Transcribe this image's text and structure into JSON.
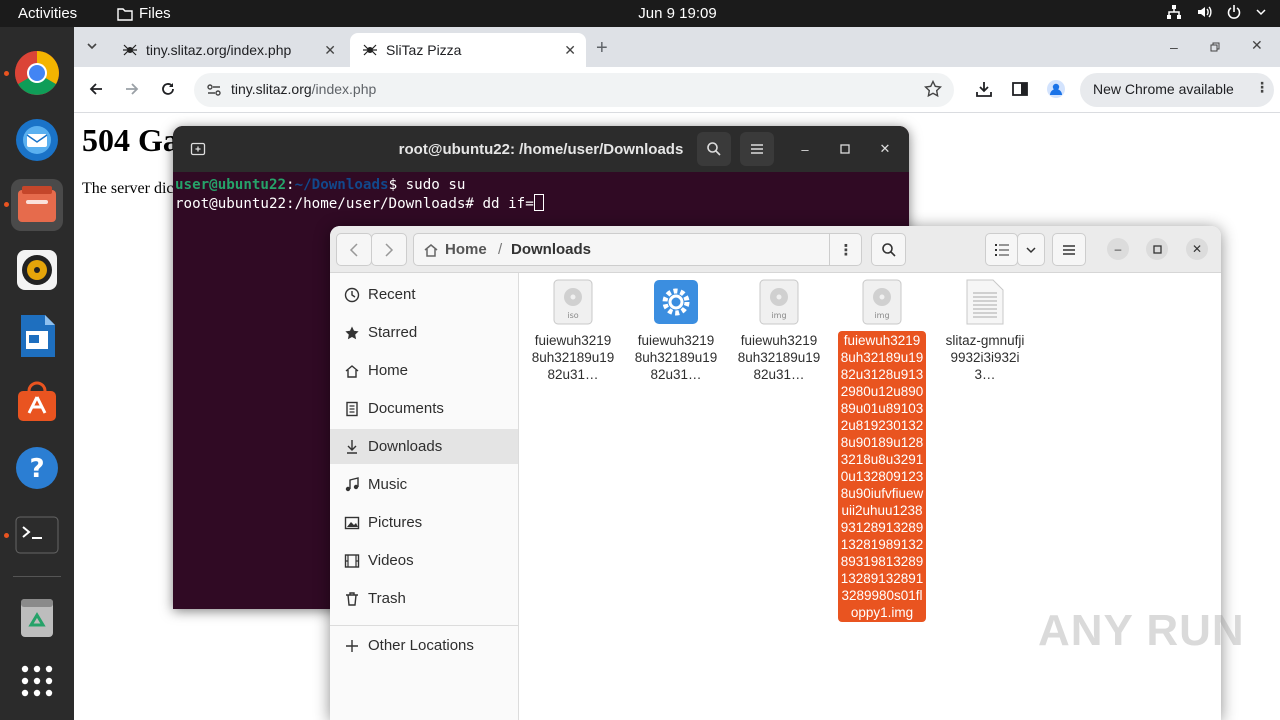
{
  "topbar": {
    "activities": "Activities",
    "app": "Files",
    "datetime": "Jun 9  19:09"
  },
  "dock": {
    "items": [
      {
        "name": "chrome",
        "running": true
      },
      {
        "name": "thunderbird",
        "running": false
      },
      {
        "name": "files",
        "running": true
      },
      {
        "name": "rhythmbox",
        "running": false
      },
      {
        "name": "libreoffice-writer",
        "running": false
      },
      {
        "name": "ubuntu-software",
        "running": false
      },
      {
        "name": "help",
        "running": false
      },
      {
        "name": "terminal",
        "running": true
      },
      {
        "name": "trash",
        "running": false
      },
      {
        "name": "show-apps",
        "running": false
      }
    ]
  },
  "browser": {
    "tabs": [
      {
        "title": "tiny.slitaz.org/index.php",
        "active": false
      },
      {
        "title": "SliTaz Pizza",
        "active": true
      }
    ],
    "url_host": "tiny.slitaz.org",
    "url_path": "/index.php",
    "update_label": "New Chrome available",
    "page": {
      "heading": "504 Ga",
      "text": "The server dic"
    }
  },
  "terminal": {
    "title": "root@ubuntu22: /home/user/Downloads",
    "line1_user": "user@ubuntu22",
    "line1_colon": ":",
    "line1_path": "~/Downloads",
    "line1_cmd": "$ sudo su",
    "line2": "root@ubuntu22:/home/user/Downloads# dd if="
  },
  "files": {
    "path_home": "Home",
    "path_sep": "/",
    "path_current": "Downloads",
    "sidebar": [
      {
        "label": "Recent",
        "icon": "clock-icon"
      },
      {
        "label": "Starred",
        "icon": "star-icon"
      },
      {
        "label": "Home",
        "icon": "home-icon"
      },
      {
        "label": "Documents",
        "icon": "document-icon"
      },
      {
        "label": "Downloads",
        "icon": "download-icon",
        "active": true
      },
      {
        "label": "Music",
        "icon": "music-icon"
      },
      {
        "label": "Pictures",
        "icon": "picture-icon"
      },
      {
        "label": "Videos",
        "icon": "video-icon"
      },
      {
        "label": "Trash",
        "icon": "trash-icon"
      },
      {
        "label": "Other Locations",
        "icon": "plus-icon"
      }
    ],
    "items": [
      {
        "name": "fuiewuh32198uh32189u1982u31…",
        "type": "iso",
        "badge": "iso"
      },
      {
        "name": "fuiewuh32198uh32189u1982u31…",
        "type": "executable",
        "badge": ""
      },
      {
        "name": "fuiewuh32198uh32189u1982u31…",
        "type": "img",
        "badge": "img"
      },
      {
        "name": "fuiewuh32198uh32189u1982u3128u9132980u12u89089u01u891032u8192301328u90189u1283218u8u32910u1328091238u90iufvfiuewuii2uhuu1238931289132891328198913289319813289132891328913289980s01floppy1.img",
        "type": "img",
        "badge": "img",
        "selected": true
      },
      {
        "name": "slitaz-gmnufji9932i3i932i3…",
        "type": "text",
        "badge": ""
      }
    ]
  },
  "watermark": "ANY RUN"
}
